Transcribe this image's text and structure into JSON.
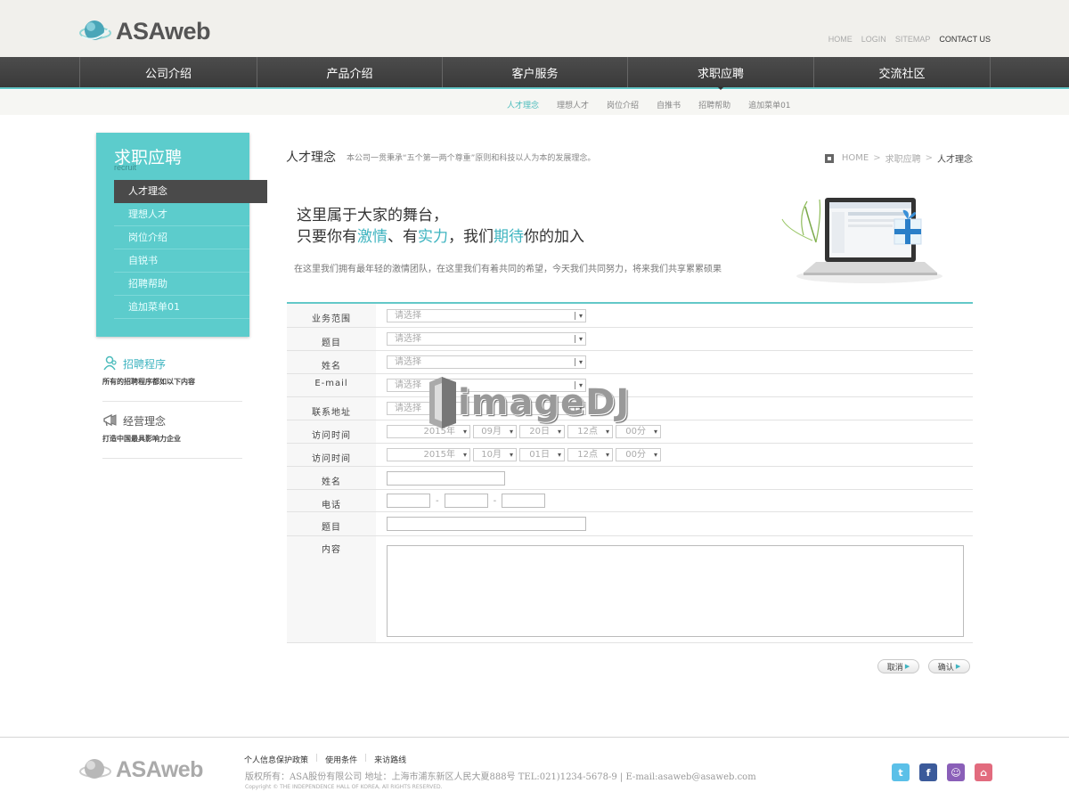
{
  "header": {
    "logo_text": "ASAweb",
    "util_links": [
      "HOME",
      "LOGIN",
      "SITEMAP",
      "CONTACT US"
    ]
  },
  "nav": {
    "items": [
      "公司介绍",
      "产品介绍",
      "客户服务",
      "求职应聘",
      "交流社区"
    ],
    "active_index": 3
  },
  "subnav": {
    "items": [
      "人才理念",
      "理想人才",
      "岗位介绍",
      "自推书",
      "招聘帮助",
      "追加菜单01"
    ]
  },
  "sidebar": {
    "title": "求职应聘",
    "subtitle": "recruit",
    "items": [
      "人才理念",
      "理想人才",
      "岗位介绍",
      "自锐书",
      "招聘帮助",
      "追加菜单01"
    ],
    "links": [
      {
        "title": "招聘程序",
        "desc": "所有的招聘程序都如以下内容"
      },
      {
        "title": "经营理念",
        "desc": "打造中国最具影响力企业"
      }
    ]
  },
  "content": {
    "title": "人才理念",
    "desc": "本公司一贯秉承“五个第一两个尊重”原则和科技以人为本的发展理念。",
    "breadcrumb": [
      "HOME",
      "求职应聘",
      "人才理念"
    ],
    "banner": {
      "line1": "这里属于大家的舞台，",
      "line2_a": "只要你有",
      "line2_h1": "激情",
      "line2_b": "、有",
      "line2_h2": "实力",
      "line2_c": "，我们",
      "line2_h3": "期待",
      "line2_d": "你的加入",
      "paragraph": "在这里我们拥有最年轻的激情团队，在这里我们有着共同的希望，今天我们共同努力，将来我们共享累累硕果"
    }
  },
  "form": {
    "select_placeholder": "请选择",
    "labels": {
      "scope": "业务范围",
      "topic": "题目",
      "name": "姓名",
      "email": "E-mail",
      "address": "联系地址",
      "visit1": "访问时间",
      "visit2": "访问时间",
      "name2": "姓名",
      "phone": "电话",
      "topic2": "题目",
      "content": "内容"
    },
    "visit1": {
      "year": "2015年",
      "month": "09月",
      "day": "20日",
      "hour": "12点",
      "minute": "00分"
    },
    "visit2": {
      "year": "2015年",
      "month": "10月",
      "day": "01日",
      "hour": "12点",
      "minute": "00分"
    },
    "phone_sep": "-",
    "cancel": "取消",
    "confirm": "确认"
  },
  "watermark": "imageDJ",
  "footer": {
    "logo_text": "ASAweb",
    "links": [
      "个人信息保护政策",
      "使用条件",
      "来访路线"
    ],
    "address": "版权所有：ASA股份有限公司 地址：上海市浦东新区人民大夏888号 TEL:021)1234-5678-9 | E-mail:asaweb@asaweb.com",
    "copyright": "Copyright © THE INDEPENDENCE HALL OF KOREA, All RIGHTS RESERVED."
  },
  "colors": {
    "accent": "#5ccccc",
    "nav": "#444444",
    "highlight": "#3fb4c0"
  }
}
